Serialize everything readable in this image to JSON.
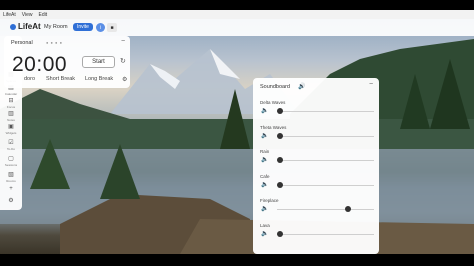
{
  "menubar": {
    "items": [
      "LifeAt",
      "View",
      "Edit"
    ]
  },
  "topbar": {
    "logo": "LifeAt",
    "my_room": "My Room",
    "invite": "Invite",
    "info": "i",
    "camera_icon": "video-camera-icon"
  },
  "sidebar": {
    "items": [
      {
        "icon": "▦",
        "label": "Spaces"
      },
      {
        "icon": "▤",
        "label": "Calendar"
      },
      {
        "icon": "⊟",
        "label": "Focus"
      },
      {
        "icon": "▥",
        "label": "Notes"
      },
      {
        "icon": "▣",
        "label": "Widgets"
      },
      {
        "icon": "☑",
        "label": "To-Do"
      },
      {
        "icon": "▢",
        "label": "Sessions"
      },
      {
        "icon": "▧",
        "label": "Rooms"
      },
      {
        "icon": "+",
        "label": ""
      },
      {
        "icon": "⚙",
        "label": ""
      }
    ]
  },
  "timer": {
    "profile": "Personal",
    "dots": "● ● ● ●",
    "minimize": "−",
    "time": "20:00",
    "start": "Start",
    "reset": "↻",
    "tabs": [
      "doro",
      "Short Break",
      "Long Break"
    ],
    "settings": "⚙"
  },
  "soundboard": {
    "title": "Soundboard",
    "minimize": "−",
    "tracks": [
      {
        "name": "Delta Waves",
        "level": 0
      },
      {
        "name": "Theta Waves",
        "level": 0
      },
      {
        "name": "Rain",
        "level": 0
      },
      {
        "name": "Cafe",
        "level": 0
      },
      {
        "name": "Fireplace",
        "level": 0.75
      },
      {
        "name": "Lava",
        "level": 0
      }
    ]
  }
}
